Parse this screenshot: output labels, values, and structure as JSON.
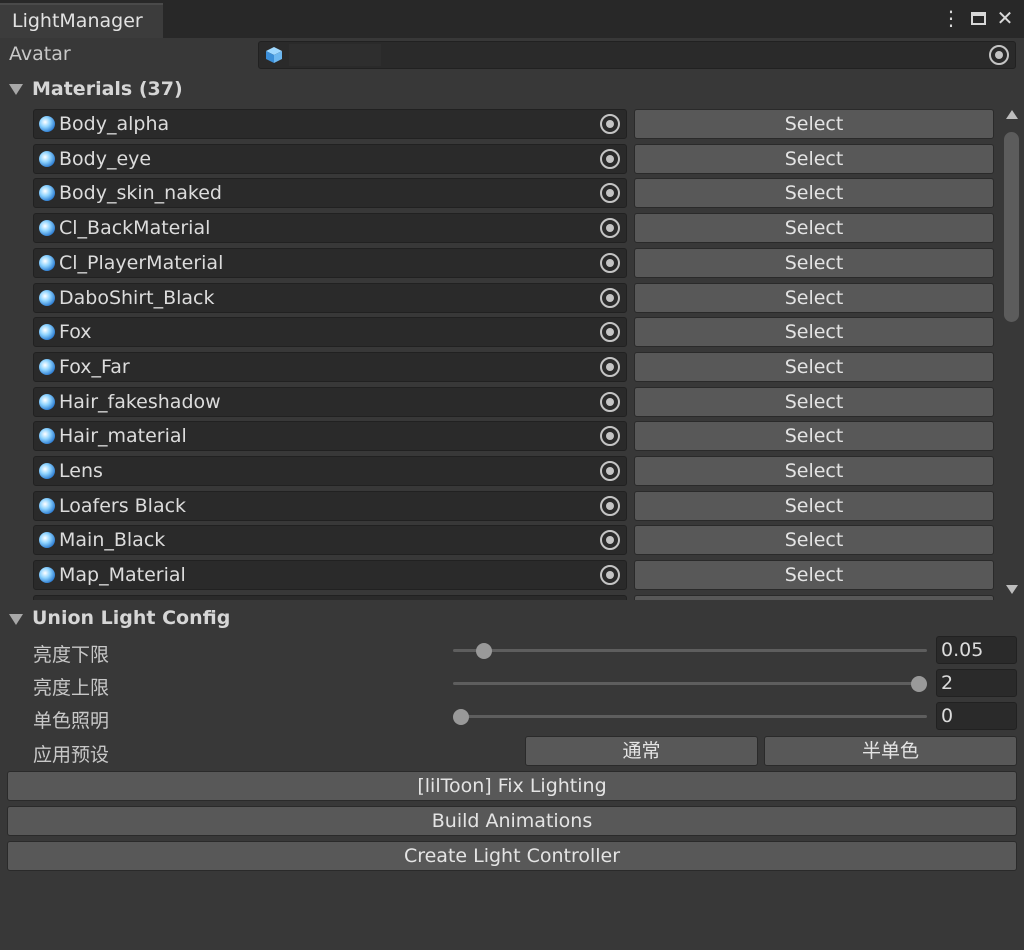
{
  "window": {
    "tab_title": "LightManager",
    "menu_icon": "kebab-menu-icon",
    "maximize_icon": "maximize-icon",
    "close_icon": "close-icon"
  },
  "avatar": {
    "label": "Avatar",
    "value_icon": "prefab-cube-icon",
    "picker_icon": "object-picker-icon"
  },
  "materials": {
    "header": "Materials (37)",
    "button_label": "Select",
    "items": [
      "Body_alpha",
      "Body_eye",
      "Body_skin_naked",
      "Cl_BackMaterial",
      "Cl_PlayerMaterial",
      "DaboShirt_Black",
      "Fox",
      "Fox_Far",
      "Hair_fakeshadow",
      "Hair_material",
      "Lens",
      "Loafers Black",
      "Main_Black",
      "Map_Material"
    ]
  },
  "union_light": {
    "header": "Union Light Config",
    "sliders": [
      {
        "label": "亮度下限",
        "value": "0.05",
        "fraction": 0.05
      },
      {
        "label": "亮度上限",
        "value": "2",
        "fraction": 1.0
      },
      {
        "label": "单色照明",
        "value": "0",
        "fraction": 0.0
      }
    ],
    "preset_label": "应用预设",
    "preset_buttons": [
      "通常",
      "半单色"
    ]
  },
  "actions": [
    "[lilToon] Fix Lighting",
    "Build Animations",
    "Create Light Controller"
  ]
}
